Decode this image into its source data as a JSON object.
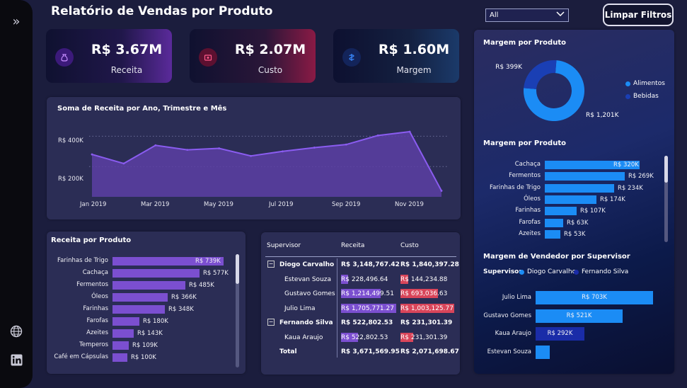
{
  "header": {
    "title": "Relatório de Vendas por Produto",
    "filter_value": "All",
    "clear_button": "Limpar Filtros"
  },
  "kpis": [
    {
      "value": "R$ 3.67M",
      "label": "Receita"
    },
    {
      "value": "R$ 2.07M",
      "label": "Custo"
    },
    {
      "value": "R$ 1.60M",
      "label": "Margem"
    }
  ],
  "area_chart": {
    "title": "Soma de Receita por Ano, Trimestre e Mês",
    "y_ticks": [
      "R$ 400K",
      "R$ 200K"
    ],
    "x_ticks": [
      "Jan 2019",
      "Mar 2019",
      "May 2019",
      "Jul 2019",
      "Sep 2019",
      "Nov 2019"
    ]
  },
  "chart_data": [
    {
      "type": "area",
      "title": "Soma de Receita por Ano, Trimestre e Mês",
      "x": [
        "Jan 2019",
        "Feb 2019",
        "Mar 2019",
        "Apr 2019",
        "May 2019",
        "Jun 2019",
        "Jul 2019",
        "Aug 2019",
        "Sep 2019",
        "Oct 2019",
        "Nov 2019",
        "Dec 2019"
      ],
      "values": [
        280000,
        220000,
        340000,
        310000,
        320000,
        270000,
        300000,
        325000,
        345000,
        405000,
        430000,
        40000
      ],
      "ylim": [
        0,
        500000
      ],
      "grid": true
    },
    {
      "type": "bar",
      "title": "Receita por Produto",
      "categories": [
        "Farinhas de Trigo",
        "Cachaça",
        "Fermentos",
        "Óleos",
        "Farinhas",
        "Farofas",
        "Azeites",
        "Temperos",
        "Café em Cápsulas"
      ],
      "values": [
        739000,
        577000,
        485000,
        366000,
        348000,
        180000,
        143000,
        109000,
        100000
      ],
      "labels": [
        "R$ 739K",
        "R$ 577K",
        "R$ 485K",
        "R$ 366K",
        "R$ 348K",
        "R$ 180K",
        "R$ 143K",
        "R$ 109K",
        "R$ 100K"
      ],
      "color": "#7b4fd0"
    },
    {
      "type": "pie",
      "title": "Margem por Produto",
      "categories": [
        "Alimentos",
        "Bebidas"
      ],
      "values": [
        1201000,
        399000
      ],
      "labels": [
        "R$ 1,201K",
        "R$ 399K"
      ],
      "colors": [
        "#1b8cf5",
        "#1a3fb4"
      ],
      "legend": "right"
    },
    {
      "type": "bar",
      "title": "Margem por Produto",
      "categories": [
        "Cachaça",
        "Fermentos",
        "Farinhas de Trigo",
        "Óleos",
        "Farinhas",
        "Farofas",
        "Azeites"
      ],
      "values": [
        320000,
        269000,
        234000,
        174000,
        107000,
        63000,
        53000
      ],
      "labels": [
        "R$ 320K",
        "R$ 269K",
        "R$ 234K",
        "R$ 174K",
        "R$ 107K",
        "R$ 63K",
        "R$ 53K"
      ],
      "color": "#1b8cf5"
    },
    {
      "type": "bar",
      "title": "Margem de Vendedor por Supervisor",
      "categories": [
        "Julio Lima",
        "Gustavo Gomes",
        "Kaua Araujo",
        "Estevan Souza"
      ],
      "values": [
        703000,
        521000,
        292000,
        84000
      ],
      "labels": [
        "R$ 703K",
        "R$ 521K",
        "R$ 292K",
        ""
      ],
      "series_of_bar": [
        "Diogo Carvalho",
        "Diogo Carvalho",
        "Fernando Silva",
        "Diogo Carvalho"
      ],
      "colors": {
        "Diogo Carvalho": "#1b8cf5",
        "Fernando Silva": "#1a2ca8"
      }
    }
  ],
  "bar_panel": {
    "title": "Receita por Produto"
  },
  "donut_panel": {
    "title": "Margem por Produto",
    "legend": [
      "Alimentos",
      "Bebidas"
    ]
  },
  "margin_panel": {
    "title": "Margem por Produto"
  },
  "supervisor_panel": {
    "title": "Margem de Vendedor por Supervisor",
    "legend_title": "Supervisor",
    "legend": [
      "Diogo Carvalho",
      "Fernando Silva"
    ]
  },
  "matrix": {
    "headers": [
      "Supervisor",
      "Receita",
      "Custo"
    ],
    "rows": [
      {
        "name": "Diogo Carvalho",
        "receita": "R$ 3,148,767.42",
        "custo": "R$ 1,840,397.28",
        "group": true,
        "r": 0,
        "c": 0
      },
      {
        "name": "Estevan Souza",
        "receita": "R$ 228,496.64",
        "custo": "R$ 144,234.88",
        "group": false,
        "r": 0.134,
        "c": 0.144
      },
      {
        "name": "Gustavo Gomes",
        "receita": "R$ 1,214,499.51",
        "custo": "R$ 693,036.63",
        "group": false,
        "r": 0.712,
        "c": 0.691
      },
      {
        "name": "Julio Lima",
        "receita": "R$ 1,705,771.27",
        "custo": "R$ 1,003,125.77",
        "group": false,
        "r": 1.0,
        "c": 1.0
      },
      {
        "name": "Fernando Silva",
        "receita": "R$ 522,802.53",
        "custo": "R$ 231,301.39",
        "group": true,
        "r": 0,
        "c": 0
      },
      {
        "name": "Kaua Araujo",
        "receita": "R$ 522,802.53",
        "custo": "R$ 231,301.39",
        "group": false,
        "r": 0.306,
        "c": 0.231
      },
      {
        "name": "Total",
        "receita": "R$ 3,671,569.95",
        "custo": "R$ 2,071,698.67",
        "group": "total",
        "r": 0,
        "c": 0
      }
    ]
  },
  "icons": {
    "expand": "chevrons-right-icon",
    "web": "globe-icon",
    "social": "linkedin-icon",
    "kpi": [
      "money-bag-icon",
      "coin-icon",
      "margin-icon"
    ]
  }
}
